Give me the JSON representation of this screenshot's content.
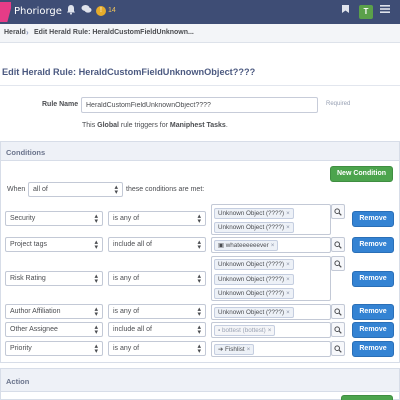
{
  "topbar": {
    "brand": "Phoriorge",
    "notification_count": "14",
    "avatar_letter": "T"
  },
  "breadcrumb": {
    "root": "Herald",
    "separator": "›",
    "current": "Edit Herald Rule: HeraldCustomFieldUnknown..."
  },
  "page": {
    "title": "Edit Herald Rule: HeraldCustomFieldUnknownObject????"
  },
  "form": {
    "rule_name_label": "Rule Name",
    "rule_name_value": "HeraldCustomFieldUnknownObject????",
    "required_label": "Required",
    "trigger_prefix": "This ",
    "trigger_scope": "Global",
    "trigger_middle": " rule triggers for ",
    "trigger_object": "Maniphest Tasks",
    "trigger_suffix": "."
  },
  "conditions": {
    "panel_title": "Conditions",
    "new_condition_label": "New Condition",
    "when_label": "When",
    "when_value": "all of",
    "when_suffix": "these conditions are met:",
    "remove_label": "Remove",
    "rows": [
      {
        "field": "Security",
        "operator": "is any of",
        "tokens": [
          {
            "text": "Unknown Object (????)"
          },
          {
            "text": "Unknown Object (????)"
          }
        ]
      },
      {
        "field": "Project tags",
        "operator": "include all of",
        "tokens": [
          {
            "text": "whateeeeeever"
          }
        ]
      },
      {
        "field": "Risk Rating",
        "operator": "is any of",
        "tokens": [
          {
            "text": "Unknown Object (????)"
          },
          {
            "text": "Unknown Object (????)"
          },
          {
            "text": "Unknown Object (????)"
          }
        ]
      },
      {
        "field": "Author Affiliation",
        "operator": "is any of",
        "tokens": [
          {
            "text": "Unknown Object (????)"
          }
        ]
      },
      {
        "field": "Other Assignee",
        "operator": "include all of",
        "tokens": [
          {
            "text": "bottest (bottest)"
          }
        ]
      },
      {
        "field": "Priority",
        "operator": "is any of",
        "tokens": [
          {
            "text": "Fishlist"
          }
        ]
      }
    ]
  },
  "action": {
    "panel_title": "Action"
  },
  "icons": {
    "logo": "phorge-logo-icon",
    "bell": "bell-icon",
    "chat": "chat-icon",
    "notification": "notification-dot-icon",
    "flag": "flag-icon",
    "menu": "menu-icon",
    "search": "search-icon",
    "project": "briefcase-icon",
    "priority": "arrow-right-icon"
  },
  "colors": {
    "topbar": "#3e4d75",
    "accent": "#e63c87",
    "green": "#4ca44d",
    "blue": "#3483d3",
    "avatar": "#5ba04a"
  }
}
